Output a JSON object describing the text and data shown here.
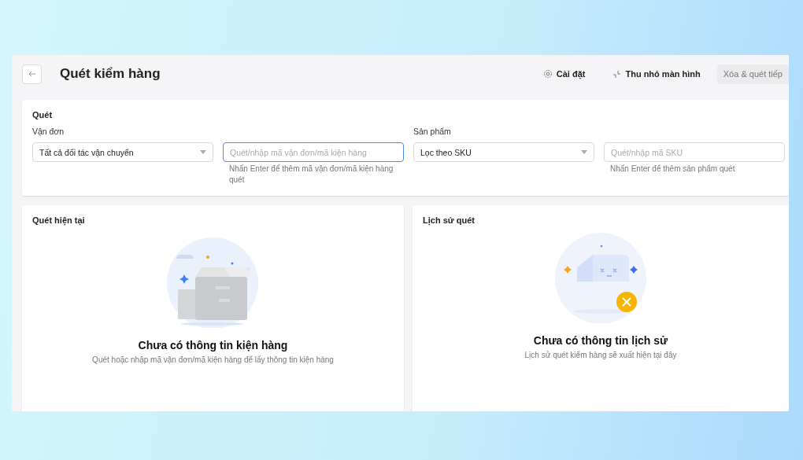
{
  "header": {
    "title": "Quét kiểm hàng",
    "actions": [
      {
        "kind": "settings",
        "label": "Cài đặt"
      },
      {
        "kind": "minimize",
        "label": "Thu nhỏ màn hình"
      },
      {
        "kind": "button",
        "label": "Xóa & quét tiếp"
      }
    ]
  },
  "scan": {
    "title": "Quét",
    "groups": [
      {
        "label": "Vận đơn",
        "select": "Tất cả đối tác vận chuyển",
        "placeholder": "Quét/nhập mã vận đơn/mã kiện hàng",
        "hint": "Nhấn Enter để thêm mã vận đơn/mã kiện hàng quét",
        "focused": true
      },
      {
        "label": "Sản phẩm",
        "select": "Lọc theo SKU",
        "placeholder": "Quét/nhập mã SKU",
        "hint": "Nhấn Enter để thêm sản phẩm quét",
        "focused": false
      }
    ]
  },
  "panels": [
    {
      "title": "Quét hiện tại",
      "kind": "box",
      "empty_title": "Chưa có thông tin kiện hàng",
      "empty_text": "Quét hoặc nhập mã vận đơn/mã kiện hàng để lấy thông tin kiện hàng"
    },
    {
      "title": "Lịch sử quét",
      "kind": "history",
      "empty_title": "Chưa có thông tin lịch sử",
      "empty_text": "Lịch sử quét kiểm hàng sẽ xuất hiện tại đây"
    }
  ]
}
